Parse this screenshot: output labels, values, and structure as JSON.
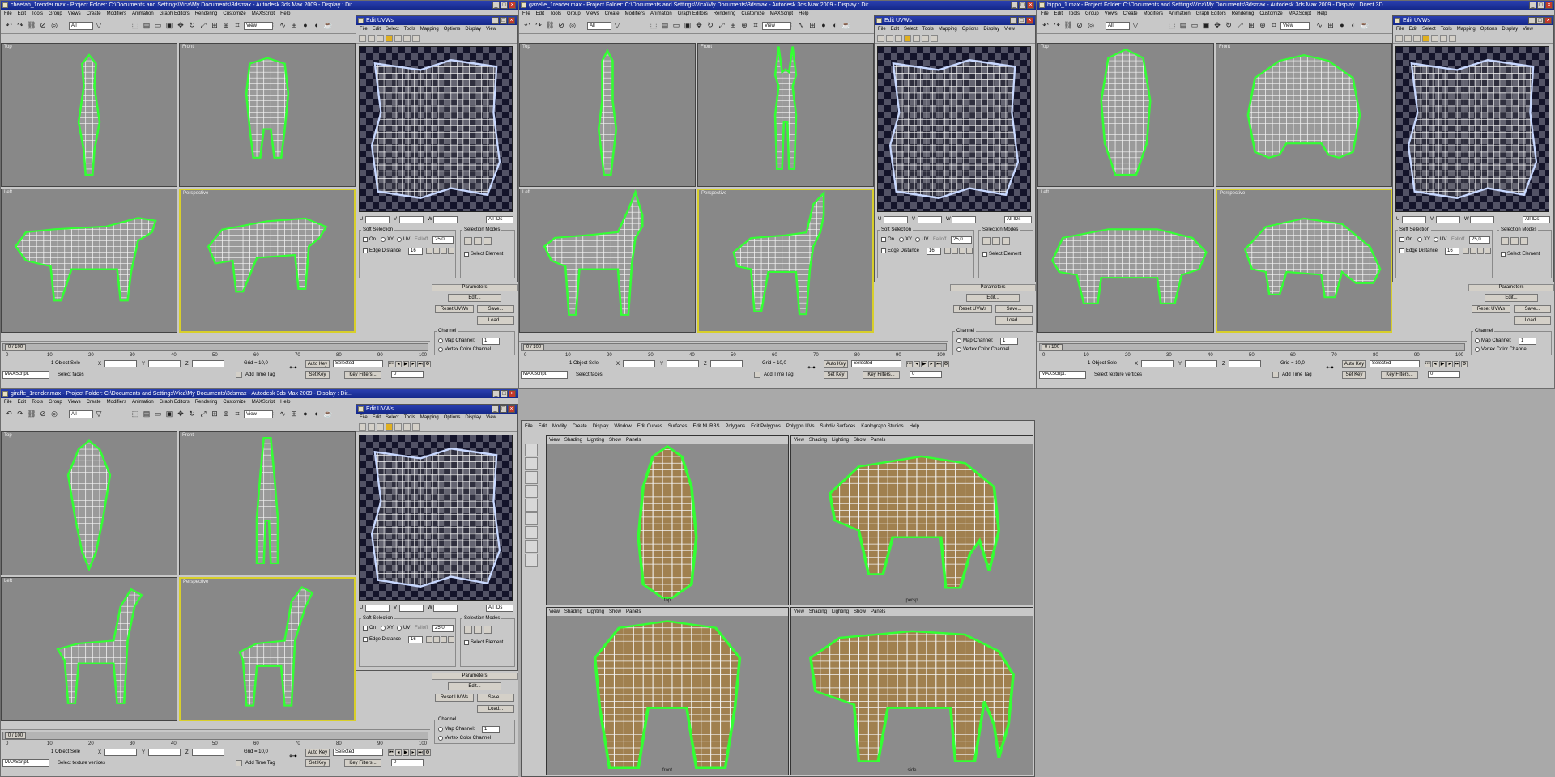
{
  "windows": [
    {
      "title": "cheetah_1render.max - Project Folder: C:\\Documents and Settings\\Vica\\My Documents\\3dsmax - Autodesk 3ds Max 2009 - Display : Dir...",
      "selection_filter": "All",
      "view_dropdown": "View",
      "viewports": [
        "Top",
        "Front",
        "Left",
        "Perspective"
      ],
      "uvw_title": "Edit UVWs",
      "frame": "0 / 100",
      "status_left": "1 Object Sele",
      "status_prompt": "Select faces",
      "grid": "Grid = 10,0",
      "maxscript": "MAXScript.",
      "animal": "cheetah"
    },
    {
      "title": "gazelle_1render.max - Project Folder: C:\\Documents and Settings\\Vica\\My Documents\\3dsmax - Autodesk 3ds Max 2009 - Display : Dir...",
      "selection_filter": "All",
      "view_dropdown": "View",
      "viewports": [
        "Top",
        "Front",
        "Left",
        "Perspective"
      ],
      "uvw_title": "Edit UVWs",
      "frame": "0 / 100",
      "status_left": "1 Object Sele",
      "status_prompt": "Select faces",
      "grid": "Grid = 10,0",
      "maxscript": "MAXScript.",
      "animal": "gazelle"
    },
    {
      "title": "hippo_1.max - Project Folder: C:\\Documents and Settings\\Vica\\My Documents\\3dsmax - Autodesk 3ds Max 2009 - Display : Direct 3D",
      "selection_filter": "All",
      "view_dropdown": "View",
      "viewports": [
        "Top",
        "Front",
        "Left",
        "Perspective"
      ],
      "uvw_title": "Edit UVWs",
      "frame": "0 / 100",
      "status_left": "1 Object Sele",
      "status_prompt": "Select texture vertices",
      "grid": "Grid = 10,0",
      "maxscript": "MAXScript.",
      "animal": "hippo"
    },
    {
      "title": "giraffe_1render.max - Project Folder: C:\\Documents and Settings\\Vica\\My Documents\\3dsmax - Autodesk 3ds Max 2009 - Display : Dir...",
      "selection_filter": "All",
      "view_dropdown": "View",
      "viewports": [
        "Top",
        "Front",
        "Left",
        "Perspective"
      ],
      "uvw_title": "Edit UVWs",
      "frame": "0 / 100",
      "status_left": "1 Object Sele",
      "status_prompt": "Select texture vertices",
      "grid": "Grid = 10,0",
      "maxscript": "MAXScript.",
      "animal": "giraffe"
    }
  ],
  "menus": [
    "File",
    "Edit",
    "Tools",
    "Group",
    "Views",
    "Create",
    "Modifiers",
    "Animation",
    "Graph Editors",
    "Rendering",
    "Customize",
    "MAXScript",
    "Help"
  ],
  "uvw_menu": [
    "File",
    "Edit",
    "Select",
    "Tools",
    "Mapping",
    "Options",
    "Display",
    "View"
  ],
  "ruler": [
    "0",
    "10",
    "20",
    "30",
    "40",
    "50",
    "60",
    "70",
    "80",
    "90",
    "100"
  ],
  "soft_selection": {
    "heading": "Soft Selection",
    "on": "On",
    "xy": "XY",
    "uv": "UV",
    "falloff": "Falloff",
    "falloff_val": "25,0",
    "edge_distance": "Edge Distance",
    "edge_val": "16"
  },
  "selection_modes": {
    "heading": "Selection Modes",
    "select_element": "Select Element"
  },
  "parameters": {
    "heading": "Parameters",
    "edit": "Edit...",
    "reset": "Reset UVWs",
    "save": "Save...",
    "load": "Load...",
    "channel": "Channel",
    "map_channel": "Map Channel:",
    "map_channel_val": "1",
    "vertex_color": "Vertex Color Channel"
  },
  "uvw_bottom": {
    "u": "U",
    "v": "V",
    "w": "W",
    "all_ids": "All IDs"
  },
  "anim": {
    "auto_key": "Auto Key",
    "set_key": "Set Key",
    "selected": "Selected",
    "key_filters": "Key Filters...",
    "add_time_tag": "Add Time Tag",
    "frame_field": "0",
    "x": "X",
    "y": "Y",
    "z": "Z"
  },
  "maya": {
    "menus": [
      "File",
      "Edit",
      "Modify",
      "Create",
      "Display",
      "Window",
      "Edit Curves",
      "Surfaces",
      "Edit NURBS",
      "Polygons",
      "Edit Polygons",
      "Polygon UVs",
      "Subdiv Surfaces",
      "Kaolograph Studios",
      "Help"
    ],
    "panel_menu": [
      "View",
      "Shading",
      "Lighting",
      "Show",
      "Panels"
    ],
    "views": [
      "top",
      "persp",
      "front",
      "side"
    ],
    "animal": "elephant"
  },
  "colors": {
    "wire": "#33ff33",
    "viewport": "#888888",
    "active": "#d8cf2a",
    "elephant": "#a0804f"
  }
}
